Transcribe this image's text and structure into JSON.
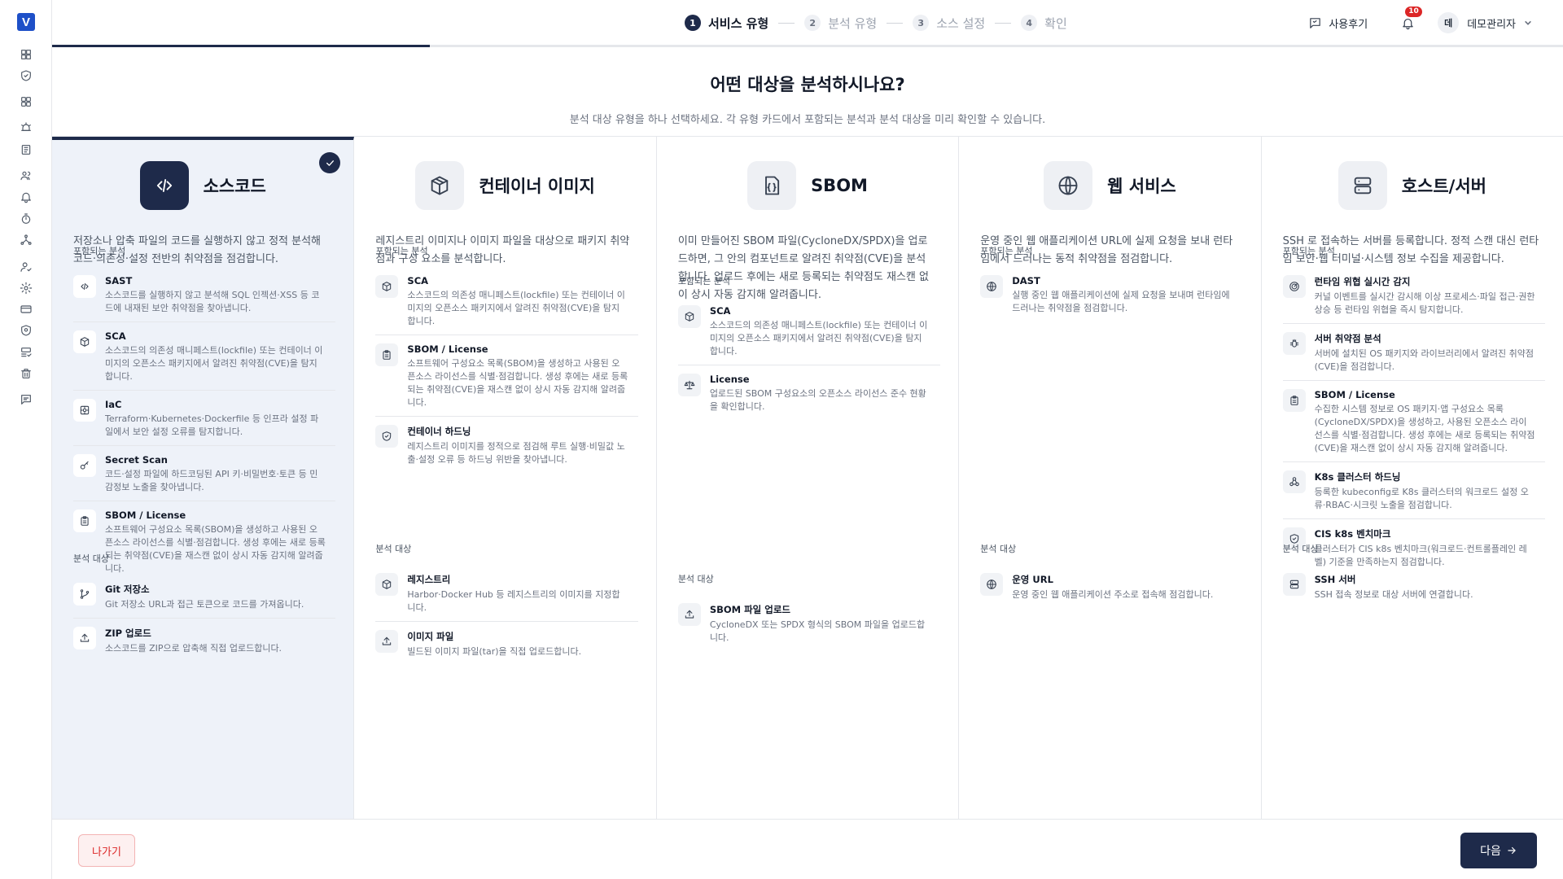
{
  "app": {
    "logo_letter": "V"
  },
  "sidebar": {
    "icons": [
      "dashboard-icon",
      "shield-check-icon",
      "grid-icon",
      "alarm-icon",
      "book-icon",
      "users-icon",
      "bell-icon",
      "timer-icon",
      "network-icon",
      "user-check-icon",
      "settings-icon",
      "credit-card-icon",
      "security-icon",
      "server-check-icon",
      "trash-icon",
      "message-icon"
    ]
  },
  "stepper": {
    "steps": [
      {
        "num": "1",
        "label": "서비스 유형"
      },
      {
        "num": "2",
        "label": "분석 유형"
      },
      {
        "num": "3",
        "label": "소스 설정"
      },
      {
        "num": "4",
        "label": "확인"
      }
    ],
    "active_step": 1,
    "progress": 0.25
  },
  "header": {
    "review_label": "사용후기",
    "notification_count": "10",
    "avatar_initial": "데",
    "user_name": "데모관리자"
  },
  "page": {
    "title": "어떤 대상을 분석하시나요?",
    "subtitle": "분석 대상 유형을 하나 선택하세요. 각 유형 카드에서 포함되는 분석과 분석 대상을 미리 확인할 수 있습니다."
  },
  "cards": [
    {
      "title": "소스코드",
      "icon": "code-icon",
      "selected": true,
      "desc_lines": [
        "저장소나 압축 파일의 코드를 실행하지 않고 정적 분석해",
        "코드·의존성·설정 전반의 취약점을 점검합니다."
      ],
      "included_label": "포함되는 분석",
      "included": [
        {
          "icon": "code-icon",
          "title": "SAST",
          "desc": [
            "소스코드를 실행하지 않고 분석해 SQL 인젝션·XSS 등 코",
            "드에 내재된 보안 취약점을 찾아냅니다."
          ]
        },
        {
          "icon": "package-icon",
          "title": "SCA",
          "desc": [
            "소스코드의 의존성 매니페스트(lockfile) 또는 컨테이너 이",
            "미지의 오픈소스 패키지에서 알려진 취약점(CVE)을 탐지",
            "합니다."
          ]
        },
        {
          "icon": "iac-icon",
          "title": "IaC",
          "desc": [
            "Terraform·Kubernetes·Dockerfile 등 인프라 설정 파",
            "일에서 보안 설정 오류를 탐지합니다."
          ]
        },
        {
          "icon": "key-icon",
          "title": "Secret Scan",
          "desc": [
            "코드·설정 파일에 하드코딩된 API 키·비밀번호·토큰 등 민",
            "감정보 노출을 찾아냅니다."
          ]
        },
        {
          "icon": "clipboard-icon",
          "title": "SBOM / License",
          "desc": [
            "소프트웨어 구성요소 목록(SBOM)을 생성하고 사용된 오",
            "픈소스 라이선스를 식별·점검합니다. 생성 후에는 새로 등록",
            "되는 취약점(CVE)을 재스캔 없이 상시 자동 감지해 알려줍",
            "니다."
          ]
        }
      ],
      "targets_label": "분석 대상",
      "targets": [
        {
          "icon": "git-branch-icon",
          "title": "Git 저장소",
          "desc": [
            "Git 저장소 URL과 접근 토큰으로 코드를 가져옵니다."
          ]
        },
        {
          "icon": "upload-icon",
          "title": "ZIP 업로드",
          "desc": [
            "소스코드를 ZIP으로 압축해 직접 업로드합니다."
          ]
        }
      ]
    },
    {
      "title": "컨테이너 이미지",
      "icon": "container-icon",
      "selected": false,
      "desc_lines": [
        "레지스트리 이미지나 이미지 파일을 대상으로 패키지 취약",
        "점과 구성 요소를 분석합니다."
      ],
      "included_label": "포함되는 분석",
      "included": [
        {
          "icon": "package-icon",
          "title": "SCA",
          "desc": [
            "소스코드의 의존성 매니페스트(lockfile) 또는 컨테이너 이",
            "미지의 오픈소스 패키지에서 알려진 취약점(CVE)을 탐지",
            "합니다."
          ]
        },
        {
          "icon": "clipboard-icon",
          "title": "SBOM / License",
          "desc": [
            "소프트웨어 구성요소 목록(SBOM)을 생성하고 사용된 오",
            "픈소스 라이선스를 식별·점검합니다. 생성 후에는 새로 등록",
            "되는 취약점(CVE)을 재스캔 없이 상시 자동 감지해 알려줍",
            "니다."
          ]
        },
        {
          "icon": "shield-check-icon",
          "title": "컨테이너 하드닝",
          "desc": [
            "레지스트리 이미지를 정적으로 점검해 루트 실행·비밀값 노",
            "출·설정 오류 등 하드닝 위반을 찾아냅니다."
          ]
        }
      ],
      "targets_label": "분석 대상",
      "targets": [
        {
          "icon": "package-icon",
          "title": "레지스트리",
          "desc": [
            "Harbor·Docker Hub 등 레지스트리의 이미지를 지정합",
            "니다."
          ]
        },
        {
          "icon": "upload-icon",
          "title": "이미지 파일",
          "desc": [
            "빌드된 이미지 파일(tar)을 직접 업로드합니다."
          ]
        }
      ]
    },
    {
      "title": "SBOM",
      "icon": "json-file-icon",
      "selected": false,
      "desc_lines": [
        "이미 만들어진 SBOM 파일(CycloneDX/SPDX)을 업로",
        "드하면, 그 안의 컴포넌트로 알려진 취약점(CVE)을 분석",
        "합니다. 업로드 후에는 새로 등록되는 취약점도 재스캔 없",
        "이 상시 자동 감지해 알려줍니다."
      ],
      "included_label": "포함되는 분석",
      "included": [
        {
          "icon": "package-icon",
          "title": "SCA",
          "desc": [
            "소스코드의 의존성 매니페스트(lockfile) 또는 컨테이너 이",
            "미지의 오픈소스 패키지에서 알려진 취약점(CVE)을 탐지",
            "합니다."
          ]
        },
        {
          "icon": "scale-icon",
          "title": "License",
          "desc": [
            "업로드된 SBOM 구성요소의 오픈소스 라이선스 준수 현황",
            "을 확인합니다."
          ]
        }
      ],
      "targets_label": "분석 대상",
      "targets": [
        {
          "icon": "upload-icon",
          "title": "SBOM 파일 업로드",
          "desc": [
            "CycloneDX 또는 SPDX 형식의 SBOM 파일을 업로드합",
            "니다."
          ]
        }
      ]
    },
    {
      "title": "웹 서비스",
      "icon": "globe-icon",
      "selected": false,
      "desc_lines": [
        "운영 중인 웹 애플리케이션 URL에 실제 요청을 보내 런타",
        "임에서 드러나는 동적 취약점을 점검합니다."
      ],
      "included_label": "포함되는 분석",
      "included": [
        {
          "icon": "globe-icon",
          "title": "DAST",
          "desc": [
            "실행 중인 웹 애플리케이션에 실제 요청을 보내며 런타임에",
            "드러나는 취약점을 점검합니다."
          ]
        }
      ],
      "targets_label": "분석 대상",
      "targets": [
        {
          "icon": "globe-icon",
          "title": "운영 URL",
          "desc": [
            "운영 중인 웹 애플리케이션 주소로 접속해 점검합니다."
          ]
        }
      ]
    },
    {
      "title": "호스트/서버",
      "icon": "server-icon",
      "selected": false,
      "desc_lines": [
        "SSH 로 접속하는 서버를 등록합니다. 정적 스캔 대신 런타",
        "임 보안·웹 터미널·시스템 정보 수집을 제공합니다."
      ],
      "included_label": "포함되는 분석",
      "included": [
        {
          "icon": "radar-icon",
          "title": "런타임 위협 실시간 감지",
          "desc": [
            "커널 이벤트를 실시간 감시해 이상 프로세스·파일 접근·권한",
            "상승 등 런타임 위협을 즉시 탐지합니다."
          ]
        },
        {
          "icon": "bug-icon",
          "title": "서버 취약점 분석",
          "desc": [
            "서버에 설치된 OS 패키지와 라이브러리에서 알려진 취약점",
            "(CVE)을 점검합니다."
          ]
        },
        {
          "icon": "clipboard-icon",
          "title": "SBOM / License",
          "desc": [
            "수집한 시스템 정보로 OS 패키지·앱 구성요소 목록",
            "(CycloneDX/SPDX)을 생성하고, 사용된 오픈소스 라이",
            "선스를 식별·점검합니다. 생성 후에는 새로 등록되는 취약점",
            "(CVE)을 재스캔 없이 상시 자동 감지해 알려줍니다."
          ]
        },
        {
          "icon": "cluster-icon",
          "title": "K8s 클러스터 하드닝",
          "desc": [
            "등록한 kubeconfig로 K8s 클러스터의 워크로드 설정 오",
            "류·RBAC·시크릿 노출을 점검합니다."
          ]
        },
        {
          "icon": "shield-check-icon",
          "title": "CIS k8s 벤치마크",
          "desc": [
            "클러스터가 CIS k8s 벤치마크(워크로드·컨트롤플레인 레",
            "벨) 기준을 만족하는지 점검합니다."
          ]
        }
      ],
      "targets_label": "분석 대상",
      "targets": [
        {
          "icon": "server-icon",
          "title": "SSH 서버",
          "desc": [
            "SSH 접속 정보로 대상 서버에 연결합니다."
          ]
        }
      ]
    }
  ],
  "footer": {
    "exit_label": "나가기",
    "next_label": "다음"
  }
}
